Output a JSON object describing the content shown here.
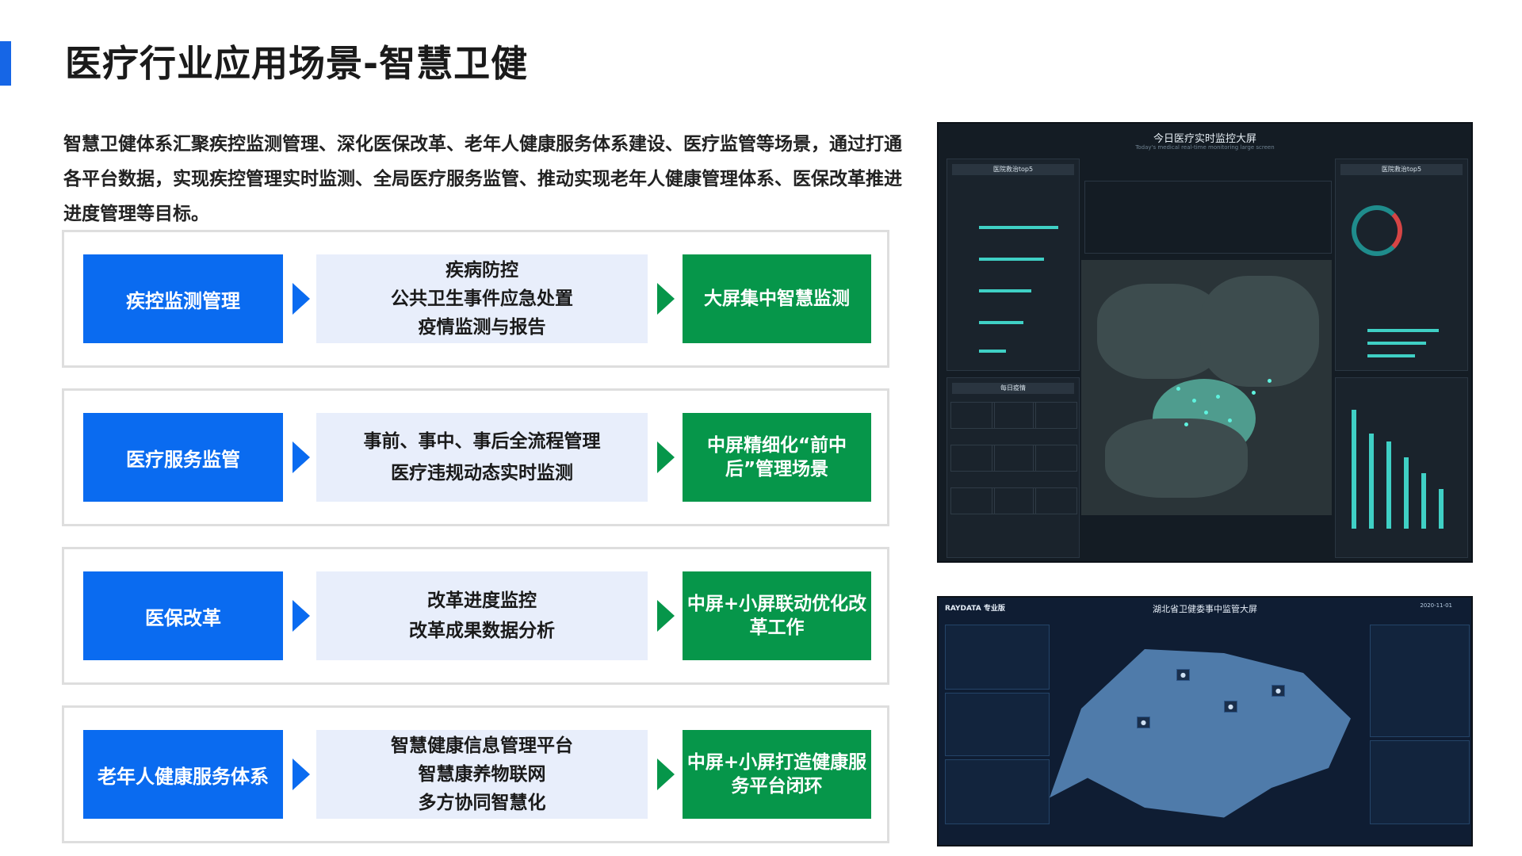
{
  "title": "医疗行业应用场景-智慧卫健",
  "intro": "智慧卫健体系汇聚疾控监测管理、深化医保改革、老年人健康服务体系建设、医疗监管等场景，通过打通各平台数据，实现疾控管理实时监测、全局医疗服务监管、推动实现老年人健康管理体系、医保改革推进进度管理等目标。",
  "rows": [
    {
      "name": "疾控监测管理",
      "details": [
        "疾病防控",
        "公共卫生事件应急处置",
        "疫情监测与报告"
      ],
      "result": "大屏集中智慧监测"
    },
    {
      "name": "医疗服务监管",
      "details": [
        "事前、事中、事后全流程管理",
        "医疗违规动态实时监测"
      ],
      "result": "中屏精细化“前中后”管理场景"
    },
    {
      "name": "医保改革",
      "details": [
        "改革进度监控",
        "改革成果数据分析"
      ],
      "result": "中屏+小屏联动优化改革工作"
    },
    {
      "name": "老年人健康服务体系",
      "details": [
        "智慧健康信息管理平台",
        "智慧康养物联网",
        "多方协同智慧化"
      ],
      "result": "中屏+小屏打造健康服务平台闭环"
    }
  ],
  "screen1": {
    "title": "今日医疗实时监控大屏",
    "subtitle": "Today's medical real-time monitoring large screen",
    "left_panel": "医院救治top5",
    "right_panel": "医院救治top5",
    "daily_panel": "每日疫情"
  },
  "screen2": {
    "brand": "RAYDATA 专业版",
    "title": "湖北省卫健委事中监管大屏",
    "date": "2020-11-01"
  }
}
